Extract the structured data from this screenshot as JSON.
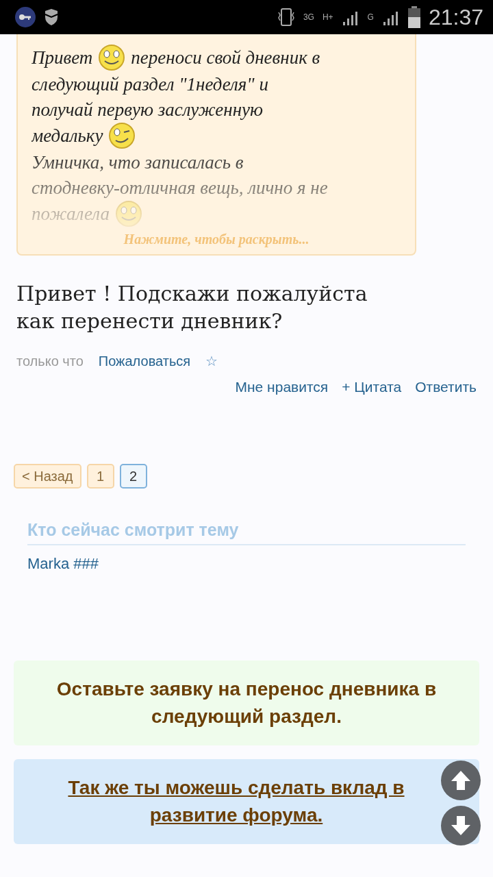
{
  "status_bar": {
    "network_labels": [
      "3G",
      "H+",
      "G"
    ],
    "time": "21:37"
  },
  "quote": {
    "lines": [
      [
        {
          "kind": "text",
          "text": "Привет"
        },
        {
          "kind": "smile"
        },
        {
          "kind": "text",
          "text": "переноси свой дневник в"
        }
      ],
      [
        {
          "kind": "text",
          "text": "следующий раздел \"1неделя\" и"
        }
      ],
      [
        {
          "kind": "text",
          "text": "получай первую заслуженную"
        }
      ],
      [
        {
          "kind": "text",
          "text": "медальку"
        },
        {
          "kind": "wink"
        }
      ],
      [
        {
          "kind": "text",
          "text": "Умничка, что записалась в"
        }
      ],
      [
        {
          "kind": "text",
          "text": "стодневку-отличная вещь, лично я не"
        }
      ],
      [
        {
          "kind": "text",
          "text": "пожалела"
        },
        {
          "kind": "smile"
        }
      ]
    ],
    "expand_label": "Нажмите, чтобы раскрыть..."
  },
  "message": "Привет ! Подскажи пожалуйста как перенести дневник?",
  "meta": {
    "time": "только что",
    "report": "Пожаловаться",
    "bookmark": "☆"
  },
  "actions": [
    "Мне нравится",
    "+ Цитата",
    "Ответить"
  ],
  "pagination": [
    {
      "label": "< Назад",
      "selected": false
    },
    {
      "label": "1",
      "selected": false
    },
    {
      "label": "2",
      "selected": true
    }
  ],
  "viewers": {
    "title": "Кто сейчас смотрит тему",
    "users": [
      "Marka ###"
    ]
  },
  "banners": [
    {
      "kind": "note",
      "text": "Оставьте заявку на перенос дневника в следующий раздел."
    },
    {
      "kind": "link",
      "text": "Так же ты можешь сделать вклад в развитие форума."
    }
  ]
}
